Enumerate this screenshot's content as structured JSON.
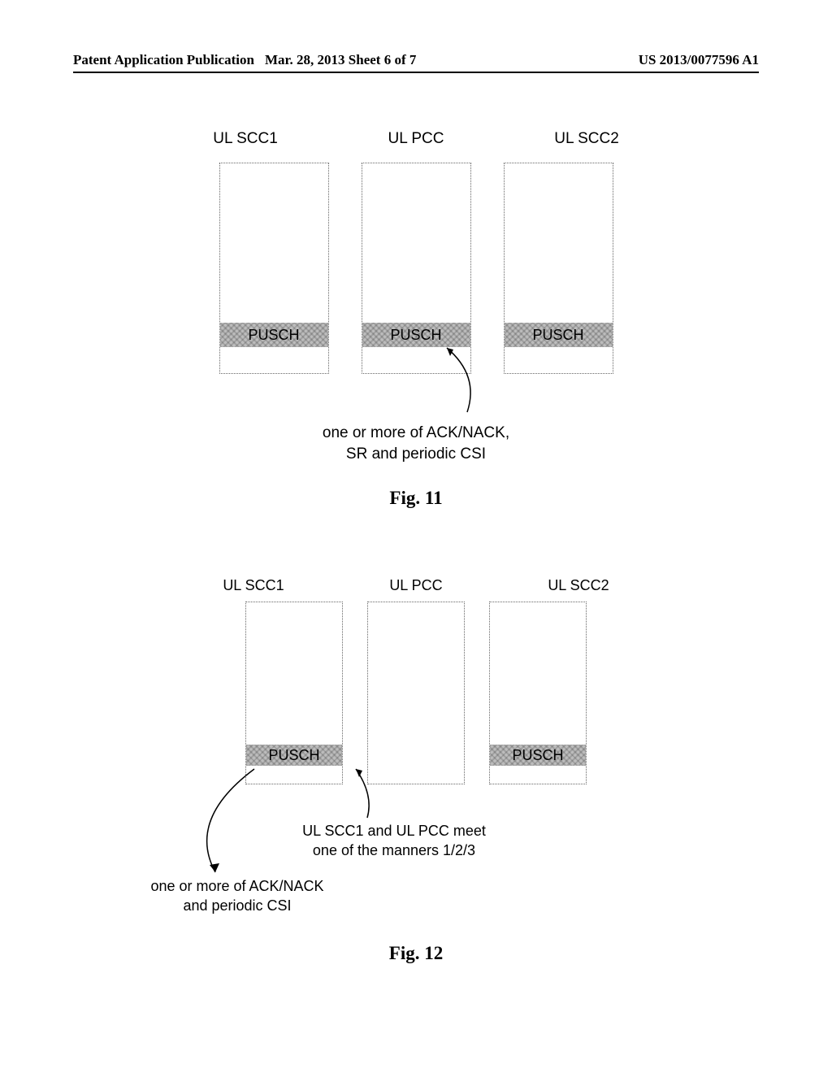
{
  "header": {
    "left": "Patent Application Publication",
    "mid": "Mar. 28, 2013  Sheet 6 of 7",
    "right": "US 2013/0077596 A1"
  },
  "fig11": {
    "labels": {
      "l1": "UL SCC1",
      "l2": "UL PCC",
      "l3": "UL SCC2"
    },
    "pusch": "PUSCH",
    "callout_line1": "one or more of ACK/NACK,",
    "callout_line2": "SR and periodic CSI",
    "caption": "Fig. 11"
  },
  "fig12": {
    "labels": {
      "l1": "UL SCC1",
      "l2": "UL PCC",
      "l3": "UL SCC2"
    },
    "pusch": "PUSCH",
    "callout1_line1": "UL SCC1 and UL PCC meet",
    "callout1_line2": "one of the manners 1/2/3",
    "callout2_line1": "one or more of ACK/NACK",
    "callout2_line2": "and periodic CSI",
    "caption": "Fig. 12"
  }
}
